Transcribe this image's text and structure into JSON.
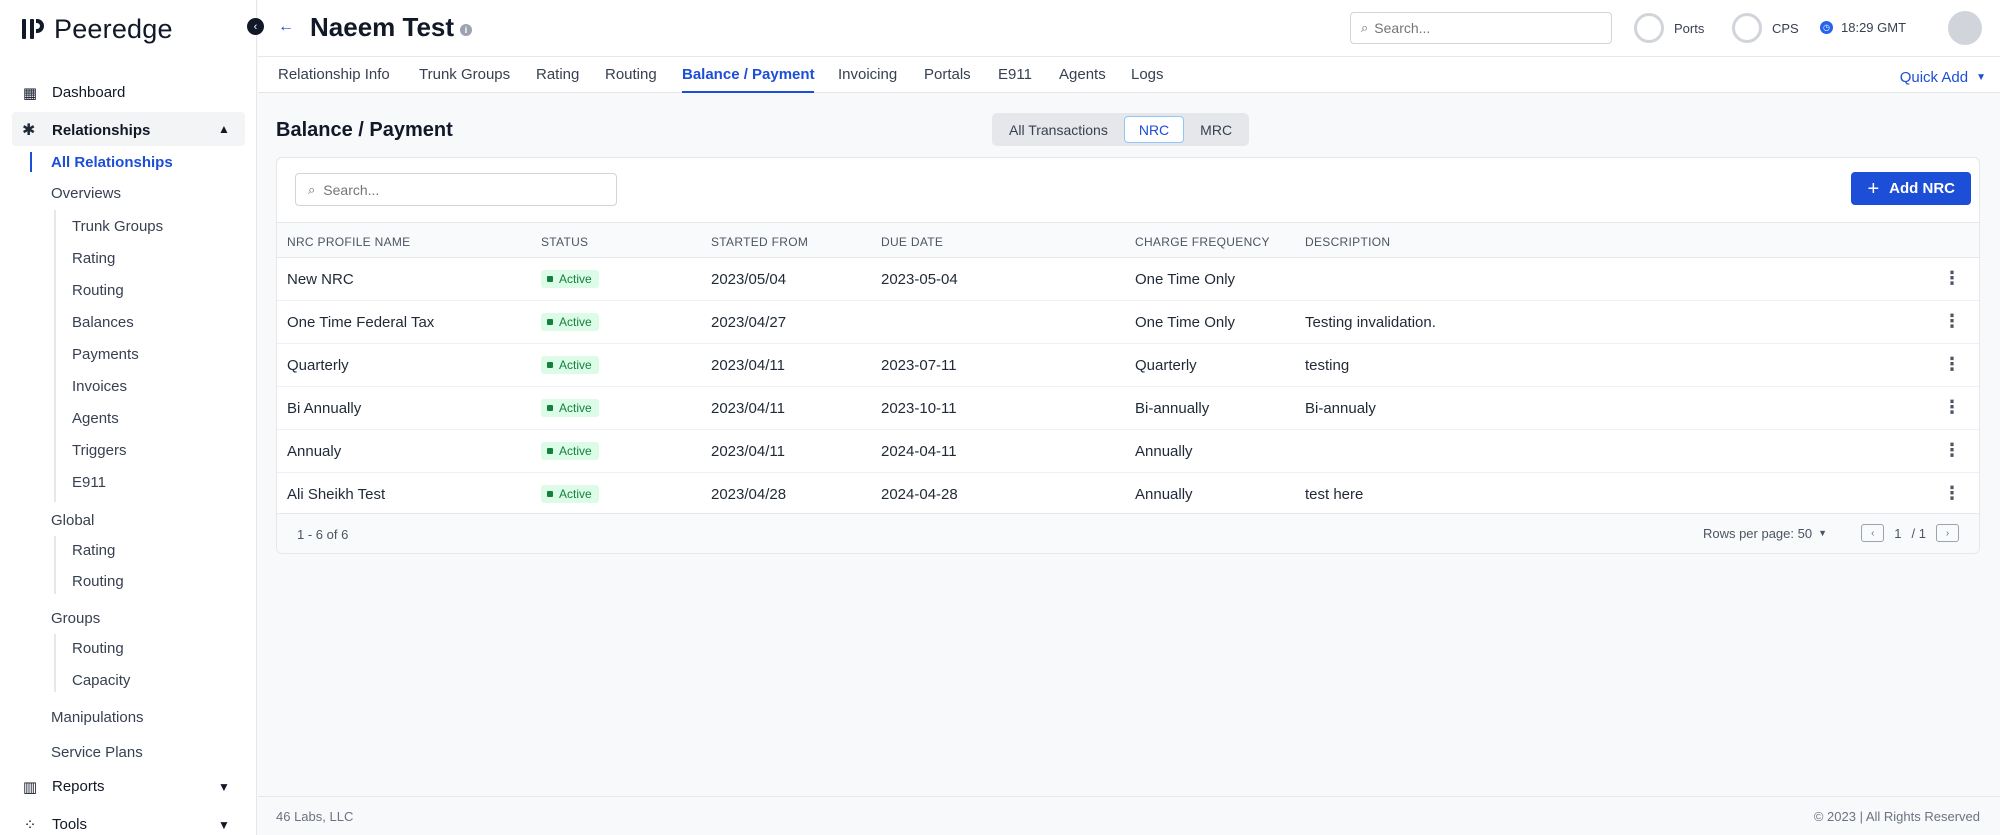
{
  "app": {
    "name": "Peeredge"
  },
  "sidebar": {
    "dashboard": "Dashboard",
    "relationships": "Relationships",
    "all_relationships": "All Relationships",
    "overviews": "Overviews",
    "overview_items": [
      "Trunk Groups",
      "Rating",
      "Routing",
      "Balances",
      "Payments",
      "Invoices",
      "Agents",
      "Triggers",
      "E911"
    ],
    "global": "Global",
    "global_items": [
      "Rating",
      "Routing"
    ],
    "groups": "Groups",
    "groups_items": [
      "Routing",
      "Capacity"
    ],
    "manipulations": "Manipulations",
    "service_plans": "Service Plans",
    "reports": "Reports",
    "tools": "Tools"
  },
  "header": {
    "title": "Naeem Test",
    "info": "i",
    "search_placeholder": "Search...",
    "ports": "Ports",
    "cps": "CPS",
    "time": "18:29 GMT"
  },
  "tabs": [
    "Relationship Info",
    "Trunk Groups",
    "Rating",
    "Routing",
    "Balance / Payment",
    "Invoicing",
    "Portals",
    "E911",
    "Agents",
    "Logs"
  ],
  "quick_add": "Quick Add",
  "main": {
    "title": "Balance / Payment",
    "segments": [
      "All Transactions",
      "NRC",
      "MRC"
    ],
    "search_placeholder": "Search...",
    "add_button": "Add NRC"
  },
  "table": {
    "columns": [
      "NRC PROFILE NAME",
      "STATUS",
      "STARTED FROM",
      "DUE DATE",
      "CHARGE FREQUENCY",
      "DESCRIPTION"
    ],
    "rows": [
      {
        "name": "New NRC",
        "status": "Active",
        "started": "2023/05/04",
        "due": "2023-05-04",
        "freq": "One Time Only",
        "desc": ""
      },
      {
        "name": "One Time Federal Tax",
        "status": "Active",
        "started": "2023/04/27",
        "due": "",
        "freq": "One Time Only",
        "desc": "Testing invalidation."
      },
      {
        "name": "Quarterly",
        "status": "Active",
        "started": "2023/04/11",
        "due": "2023-07-11",
        "freq": "Quarterly",
        "desc": "testing"
      },
      {
        "name": "Bi Annually",
        "status": "Active",
        "started": "2023/04/11",
        "due": "2023-10-11",
        "freq": "Bi-annually",
        "desc": "Bi-annualy"
      },
      {
        "name": "Annualy",
        "status": "Active",
        "started": "2023/04/11",
        "due": "2024-04-11",
        "freq": "Annually",
        "desc": ""
      },
      {
        "name": "Ali Sheikh Test",
        "status": "Active",
        "started": "2023/04/28",
        "due": "2024-04-28",
        "freq": "Annually",
        "desc": "test here"
      }
    ],
    "count": "1 - 6 of 6",
    "rows_per_page": "Rows per page: 50",
    "page": "1",
    "page_total": "/ 1"
  },
  "footer": {
    "left": "46 Labs, LLC",
    "right": "© 2023 | All Rights Reserved"
  },
  "colors": {
    "accent": "#1d4ed8",
    "active_badge_bg": "#dcfce7",
    "active_badge_text": "#15803d"
  }
}
